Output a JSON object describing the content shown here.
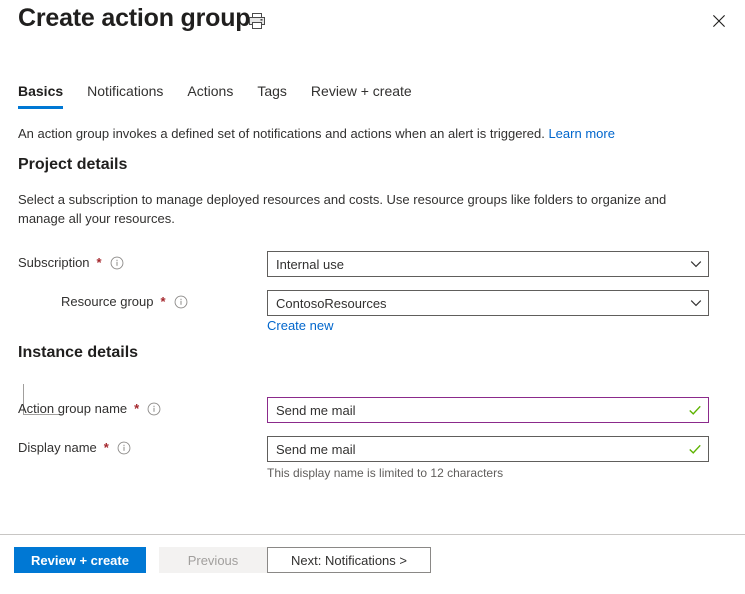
{
  "header": {
    "title": "Create action group",
    "print_icon": "printer-icon",
    "close_icon": "close-icon"
  },
  "tabs": [
    {
      "label": "Basics",
      "active": true
    },
    {
      "label": "Notifications",
      "active": false
    },
    {
      "label": "Actions",
      "active": false
    },
    {
      "label": "Tags",
      "active": false
    },
    {
      "label": "Review + create",
      "active": false
    }
  ],
  "intro": {
    "text": "An action group invokes a defined set of notifications and actions when an alert is triggered.",
    "link_label": "Learn more"
  },
  "project_details": {
    "heading": "Project details",
    "description": "Select a subscription to manage deployed resources and costs. Use resource groups like folders to organize and manage all your resources.",
    "subscription": {
      "label": "Subscription",
      "required": "*",
      "info_icon": "info-icon",
      "value": "Internal use",
      "chevron_icon": "chevron-down-icon"
    },
    "resource_group": {
      "label": "Resource group",
      "required": "*",
      "info_icon": "info-icon",
      "value": "ContosoResources",
      "chevron_icon": "chevron-down-icon",
      "create_new_label": "Create new"
    }
  },
  "instance_details": {
    "heading": "Instance details",
    "action_group_name": {
      "label": "Action group name",
      "required": "*",
      "info_icon": "info-icon",
      "value": "Send me mail",
      "valid_icon": "checkmark-icon",
      "focused": true
    },
    "display_name": {
      "label": "Display name",
      "required": "*",
      "info_icon": "info-icon",
      "value": "Send me mail",
      "valid_icon": "checkmark-icon",
      "hint": "This display name is limited to 12 characters"
    }
  },
  "footer": {
    "review_create_label": "Review + create",
    "previous_label": "Previous",
    "next_label": "Next: Notifications >"
  },
  "colors": {
    "accent": "#0078d4",
    "required_asterisk": "#a4262c",
    "link": "#0066cc",
    "valid_check": "#5db300",
    "focus_border": "#8b2a8b"
  }
}
